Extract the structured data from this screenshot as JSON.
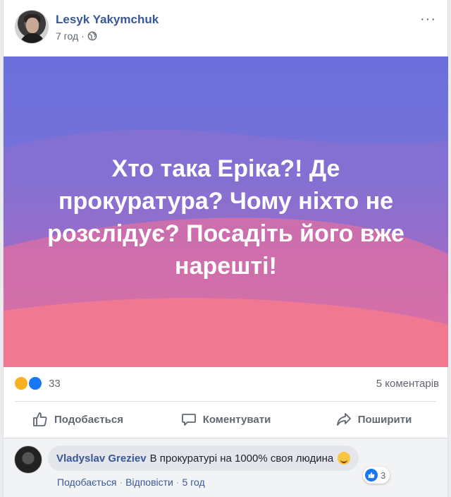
{
  "post": {
    "author": "Lesyk Yakymchuk",
    "time": "7 год",
    "separator": "·",
    "privacy_icon": "globe-icon",
    "more_label": "···"
  },
  "banner": {
    "text": "Хто така Еріка?! Де прокуратура? Чому ніхто не розслідує? Посадіть його вже нарешті!",
    "colors": {
      "top": "#6c6fdc",
      "bottom": "#f06f8c"
    }
  },
  "stats": {
    "reactions": [
      "haha-icon",
      "like-icon"
    ],
    "reaction_count": "33",
    "comments_count": "5 коментарів"
  },
  "actions": {
    "like": "Подобається",
    "comment": "Коментувати",
    "share": "Поширити"
  },
  "comment": {
    "author": "Vladyslav Greziev",
    "text": "В прокуратурі на 1000% своя людина",
    "emoji": "wink-emoji-icon",
    "reaction_count": "3",
    "like_label": "Подобається",
    "reply_label": "Відповісти",
    "time": "5 год",
    "dot": "·"
  },
  "colors": {
    "link": "#385898",
    "like_blue": "#1877f2",
    "muted": "#606770"
  }
}
